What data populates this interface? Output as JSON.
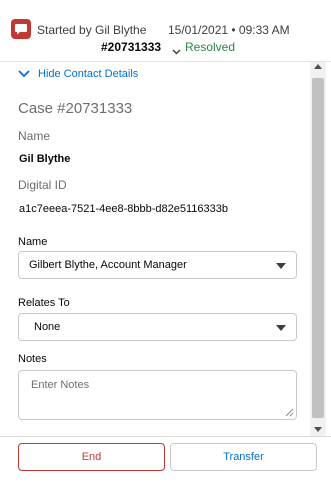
{
  "header": {
    "started_by": "Started by Gil Blythe",
    "datetime": "15/01/2021 • 09:33 AM",
    "case_number": "#20731333",
    "status": "Resolved"
  },
  "details": {
    "toggle_label": "Hide Contact Details",
    "case_title": "Case #20731333",
    "name_label": "Name",
    "name_value": "Gil Blythe",
    "digital_id_label": "Digital ID",
    "digital_id_value": "a1c7eeea-7521-4ee8-8bbb-d82e5116333b"
  },
  "form": {
    "name_label": "Name",
    "name_selected": "Gilbert Blythe, Account Manager",
    "relates_to_label": "Relates To",
    "relates_to_selected": "None",
    "notes_label": "Notes",
    "notes_placeholder": "Enter Notes"
  },
  "footer": {
    "end_label": "End",
    "transfer_label": "Transfer"
  },
  "icons": {
    "chat": "chat-bubble-icon",
    "chevron": "chevron-down-icon"
  },
  "colors": {
    "accent": "#0070d2",
    "danger": "#c23934",
    "success": "#2e844a"
  }
}
